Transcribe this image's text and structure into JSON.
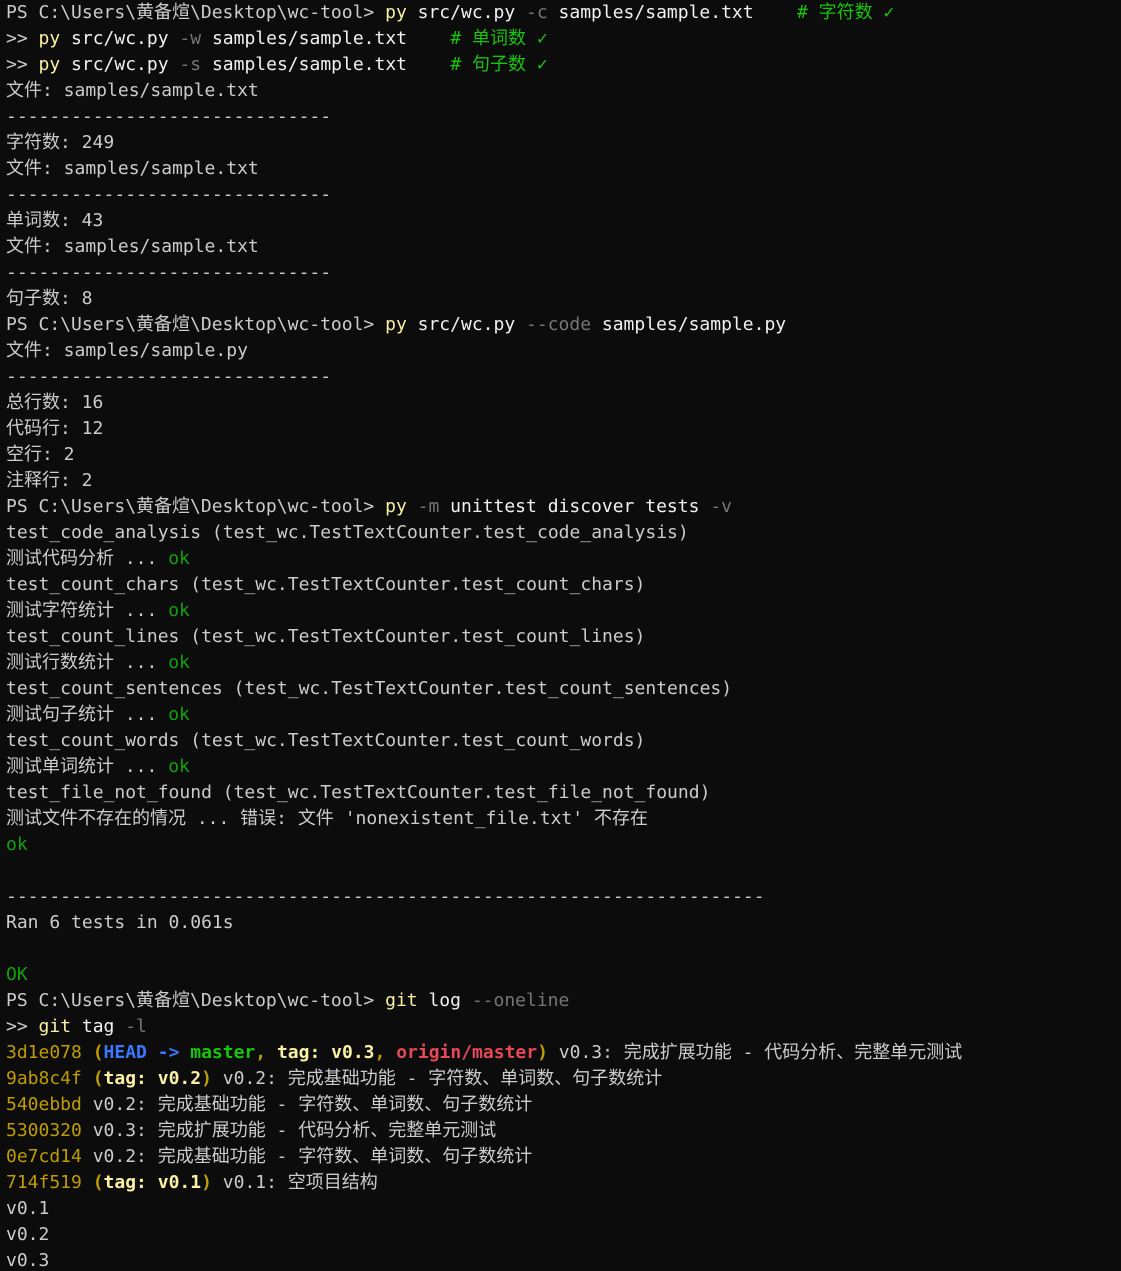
{
  "window": {
    "background": "#0c0c0c",
    "foreground": "#cccccc"
  },
  "colors": {
    "prompt": "#cccccc",
    "command": "#f9f1a5",
    "flag": "#767676",
    "comment": "#16c60c",
    "ok": "#13a10e",
    "git_hash": "#c19c00",
    "git_head": "#3b78ff",
    "git_branch": "#16c60c",
    "git_tag": "#f9f1a5",
    "git_remote": "#e74856"
  },
  "terminal": {
    "lines": [
      {
        "segments": [
          {
            "t": "PS C:\\Users\\黄备煊\\Desktop\\wc-tool> ",
            "c": "default"
          },
          {
            "t": "py",
            "c": "yellow"
          },
          {
            "t": " src/wc.py ",
            "c": "white"
          },
          {
            "t": "-c",
            "c": "gray"
          },
          {
            "t": " samples/sample.txt    ",
            "c": "white"
          },
          {
            "t": "# 字符数 ✓",
            "c": "green"
          }
        ]
      },
      {
        "segments": [
          {
            "t": ">> ",
            "c": "default"
          },
          {
            "t": "py",
            "c": "yellow"
          },
          {
            "t": " src/wc.py ",
            "c": "white"
          },
          {
            "t": "-w",
            "c": "gray"
          },
          {
            "t": " samples/sample.txt    ",
            "c": "white"
          },
          {
            "t": "# 单词数 ✓",
            "c": "green"
          }
        ]
      },
      {
        "segments": [
          {
            "t": ">> ",
            "c": "default"
          },
          {
            "t": "py",
            "c": "yellow"
          },
          {
            "t": " src/wc.py ",
            "c": "white"
          },
          {
            "t": "-s",
            "c": "gray"
          },
          {
            "t": " samples/sample.txt    ",
            "c": "white"
          },
          {
            "t": "# 句子数 ✓",
            "c": "green"
          }
        ]
      },
      {
        "segments": [
          {
            "t": "文件: samples/sample.txt",
            "c": "default"
          }
        ]
      },
      {
        "segments": [
          {
            "t": "------------------------------",
            "c": "default"
          }
        ]
      },
      {
        "segments": [
          {
            "t": "字符数: 249",
            "c": "default"
          }
        ]
      },
      {
        "segments": [
          {
            "t": "文件: samples/sample.txt",
            "c": "default"
          }
        ]
      },
      {
        "segments": [
          {
            "t": "------------------------------",
            "c": "default"
          }
        ]
      },
      {
        "segments": [
          {
            "t": "单词数: 43",
            "c": "default"
          }
        ]
      },
      {
        "segments": [
          {
            "t": "文件: samples/sample.txt",
            "c": "default"
          }
        ]
      },
      {
        "segments": [
          {
            "t": "------------------------------",
            "c": "default"
          }
        ]
      },
      {
        "segments": [
          {
            "t": "句子数: 8",
            "c": "default"
          }
        ]
      },
      {
        "segments": [
          {
            "t": "PS C:\\Users\\黄备煊\\Desktop\\wc-tool> ",
            "c": "default"
          },
          {
            "t": "py",
            "c": "yellow"
          },
          {
            "t": " src/wc.py ",
            "c": "white"
          },
          {
            "t": "--code",
            "c": "gray"
          },
          {
            "t": " samples/sample.py",
            "c": "white"
          }
        ]
      },
      {
        "segments": [
          {
            "t": "文件: samples/sample.py",
            "c": "default"
          }
        ]
      },
      {
        "segments": [
          {
            "t": "------------------------------",
            "c": "default"
          }
        ]
      },
      {
        "segments": [
          {
            "t": "总行数: 16",
            "c": "default"
          }
        ]
      },
      {
        "segments": [
          {
            "t": "代码行: 12",
            "c": "default"
          }
        ]
      },
      {
        "segments": [
          {
            "t": "空行: 2",
            "c": "default"
          }
        ]
      },
      {
        "segments": [
          {
            "t": "注释行: 2",
            "c": "default"
          }
        ]
      },
      {
        "segments": [
          {
            "t": "PS C:\\Users\\黄备煊\\Desktop\\wc-tool> ",
            "c": "default"
          },
          {
            "t": "py",
            "c": "yellow"
          },
          {
            "t": " ",
            "c": "white"
          },
          {
            "t": "-m",
            "c": "gray"
          },
          {
            "t": " unittest discover tests ",
            "c": "white"
          },
          {
            "t": "-v",
            "c": "gray"
          }
        ]
      },
      {
        "segments": [
          {
            "t": "test_code_analysis (test_wc.TestTextCounter.test_code_analysis)",
            "c": "default"
          }
        ]
      },
      {
        "segments": [
          {
            "t": "测试代码分析 ... ",
            "c": "default"
          },
          {
            "t": "ok",
            "c": "ok"
          }
        ]
      },
      {
        "segments": [
          {
            "t": "test_count_chars (test_wc.TestTextCounter.test_count_chars)",
            "c": "default"
          }
        ]
      },
      {
        "segments": [
          {
            "t": "测试字符统计 ... ",
            "c": "default"
          },
          {
            "t": "ok",
            "c": "ok"
          }
        ]
      },
      {
        "segments": [
          {
            "t": "test_count_lines (test_wc.TestTextCounter.test_count_lines)",
            "c": "default"
          }
        ]
      },
      {
        "segments": [
          {
            "t": "测试行数统计 ... ",
            "c": "default"
          },
          {
            "t": "ok",
            "c": "ok"
          }
        ]
      },
      {
        "segments": [
          {
            "t": "test_count_sentences (test_wc.TestTextCounter.test_count_sentences)",
            "c": "default"
          }
        ]
      },
      {
        "segments": [
          {
            "t": "测试句子统计 ... ",
            "c": "default"
          },
          {
            "t": "ok",
            "c": "ok"
          }
        ]
      },
      {
        "segments": [
          {
            "t": "test_count_words (test_wc.TestTextCounter.test_count_words)",
            "c": "default"
          }
        ]
      },
      {
        "segments": [
          {
            "t": "测试单词统计 ... ",
            "c": "default"
          },
          {
            "t": "ok",
            "c": "ok"
          }
        ]
      },
      {
        "segments": [
          {
            "t": "test_file_not_found (test_wc.TestTextCounter.test_file_not_found)",
            "c": "default"
          }
        ]
      },
      {
        "segments": [
          {
            "t": "测试文件不存在的情况 ... 错误: 文件 'nonexistent_file.txt' 不存在",
            "c": "default"
          }
        ]
      },
      {
        "segments": [
          {
            "t": "ok",
            "c": "ok"
          }
        ]
      },
      {
        "segments": [
          {
            "t": "",
            "c": "default"
          }
        ]
      },
      {
        "segments": [
          {
            "t": "----------------------------------------------------------------------",
            "c": "default"
          }
        ]
      },
      {
        "segments": [
          {
            "t": "Ran 6 tests in 0.061s",
            "c": "default"
          }
        ]
      },
      {
        "segments": [
          {
            "t": "",
            "c": "default"
          }
        ]
      },
      {
        "segments": [
          {
            "t": "OK",
            "c": "ok"
          }
        ]
      },
      {
        "segments": [
          {
            "t": "PS C:\\Users\\黄备煊\\Desktop\\wc-tool> ",
            "c": "default"
          },
          {
            "t": "git",
            "c": "yellow"
          },
          {
            "t": " log ",
            "c": "white"
          },
          {
            "t": "--oneline",
            "c": "gray"
          }
        ]
      },
      {
        "segments": [
          {
            "t": ">> ",
            "c": "default"
          },
          {
            "t": "git",
            "c": "yellow"
          },
          {
            "t": " tag ",
            "c": "white"
          },
          {
            "t": "-l",
            "c": "gray"
          }
        ]
      },
      {
        "segments": [
          {
            "t": "3d1e078",
            "c": "hash"
          },
          {
            "t": " (",
            "c": "paren"
          },
          {
            "t": "HEAD -> ",
            "c": "head"
          },
          {
            "t": "master",
            "c": "branch"
          },
          {
            "t": ", ",
            "c": "paren"
          },
          {
            "t": "tag: v0.3",
            "c": "tag"
          },
          {
            "t": ", ",
            "c": "paren"
          },
          {
            "t": "origin/master",
            "c": "remote"
          },
          {
            "t": ")",
            "c": "paren"
          },
          {
            "t": " v0.3: 完成扩展功能 - 代码分析、完整单元测试",
            "c": "default"
          }
        ]
      },
      {
        "segments": [
          {
            "t": "9ab8c4f",
            "c": "hash"
          },
          {
            "t": " (",
            "c": "paren"
          },
          {
            "t": "tag: v0.2",
            "c": "tag"
          },
          {
            "t": ")",
            "c": "paren"
          },
          {
            "t": " v0.2: 完成基础功能 - 字符数、单词数、句子数统计",
            "c": "default"
          }
        ]
      },
      {
        "segments": [
          {
            "t": "540ebbd",
            "c": "hash"
          },
          {
            "t": " v0.2: 完成基础功能 - 字符数、单词数、句子数统计",
            "c": "default"
          }
        ]
      },
      {
        "segments": [
          {
            "t": "5300320",
            "c": "hash"
          },
          {
            "t": " v0.3: 完成扩展功能 - 代码分析、完整单元测试",
            "c": "default"
          }
        ]
      },
      {
        "segments": [
          {
            "t": "0e7cd14",
            "c": "hash"
          },
          {
            "t": " v0.2: 完成基础功能 - 字符数、单词数、句子数统计",
            "c": "default"
          }
        ]
      },
      {
        "segments": [
          {
            "t": "714f519",
            "c": "hash"
          },
          {
            "t": " (",
            "c": "paren"
          },
          {
            "t": "tag: v0.1",
            "c": "tag"
          },
          {
            "t": ")",
            "c": "paren"
          },
          {
            "t": " v0.1: 空项目结构",
            "c": "default"
          }
        ]
      },
      {
        "segments": [
          {
            "t": "v0.1",
            "c": "default"
          }
        ]
      },
      {
        "segments": [
          {
            "t": "v0.2",
            "c": "default"
          }
        ]
      },
      {
        "segments": [
          {
            "t": "v0.3",
            "c": "default"
          }
        ]
      }
    ]
  }
}
